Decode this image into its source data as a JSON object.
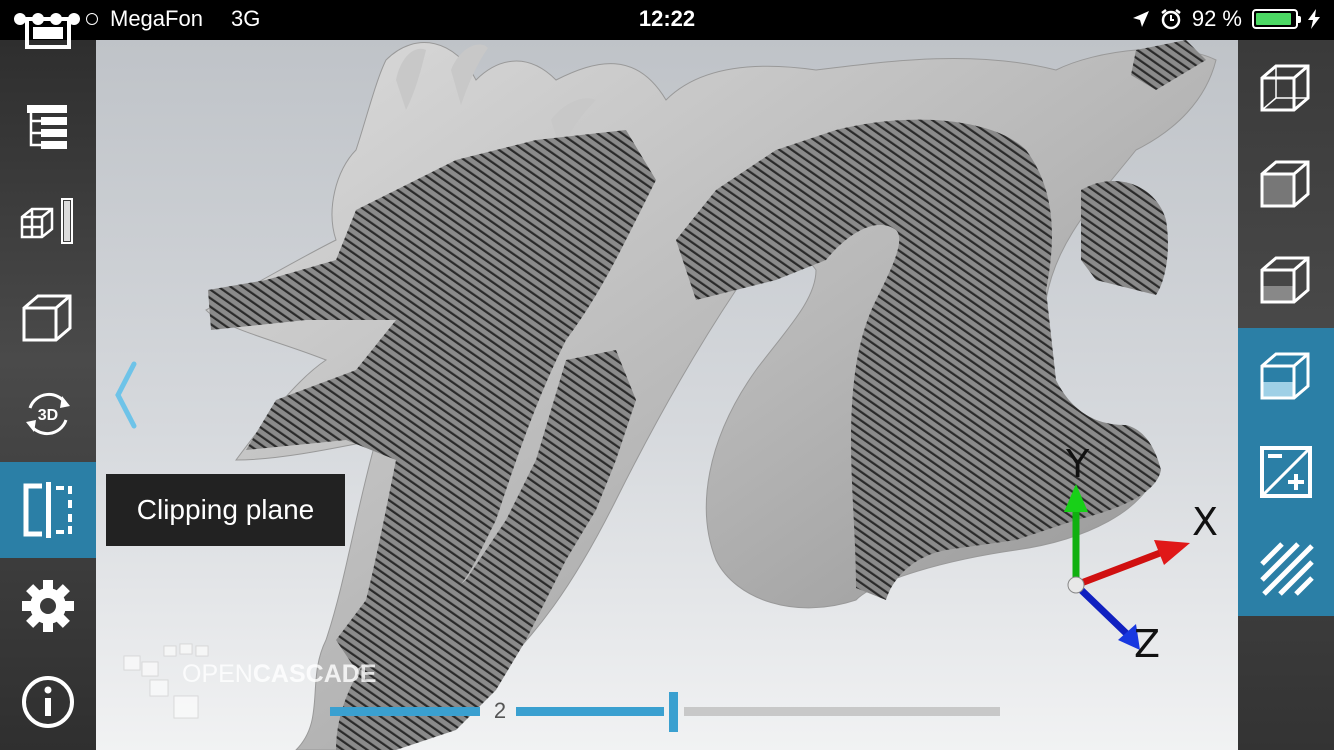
{
  "status_bar": {
    "signal_dots": 5,
    "signal_filled": 4,
    "carrier": "MegaFon",
    "network": "3G",
    "time": "12:22",
    "battery_percent": "92 %",
    "battery_level": 0.92,
    "battery_color": "#4cd964"
  },
  "left_toolbar": {
    "items": [
      {
        "name": "import-icon",
        "active": false
      },
      {
        "name": "model-tree-icon",
        "active": false
      },
      {
        "name": "explode-icon",
        "active": false
      },
      {
        "name": "wireframe-cube-icon",
        "active": false
      },
      {
        "name": "rotate-3d-icon",
        "label": "3D",
        "active": false
      },
      {
        "name": "clipping-plane-icon",
        "active": true
      },
      {
        "name": "settings-gear-icon",
        "active": false
      },
      {
        "name": "info-icon",
        "active": false
      }
    ]
  },
  "right_toolbar": {
    "items": [
      {
        "name": "display-wireframe-icon",
        "active": false
      },
      {
        "name": "display-shaded-icon",
        "active": false
      },
      {
        "name": "display-shaded-edges-icon",
        "active": false
      },
      {
        "name": "display-transparent-icon",
        "active": true
      },
      {
        "name": "add-clipping-plane-icon",
        "active": true
      },
      {
        "name": "hatching-icon",
        "active": true
      }
    ]
  },
  "tooltip": {
    "text": "Clipping plane"
  },
  "slider": {
    "value_label": "2",
    "position": 0.5
  },
  "watermark": {
    "text_light": "OPEN",
    "text_bold": "CASCADE"
  },
  "axes": {
    "x": "X",
    "y": "Y",
    "z": "Z"
  },
  "colors": {
    "accent": "#2b7fa6",
    "toolbar_bg": "#3d3d3d",
    "x_axis": "#e01010",
    "y_axis": "#10c010",
    "z_axis": "#1030e0",
    "section_hatch": "#6a6a6a"
  }
}
